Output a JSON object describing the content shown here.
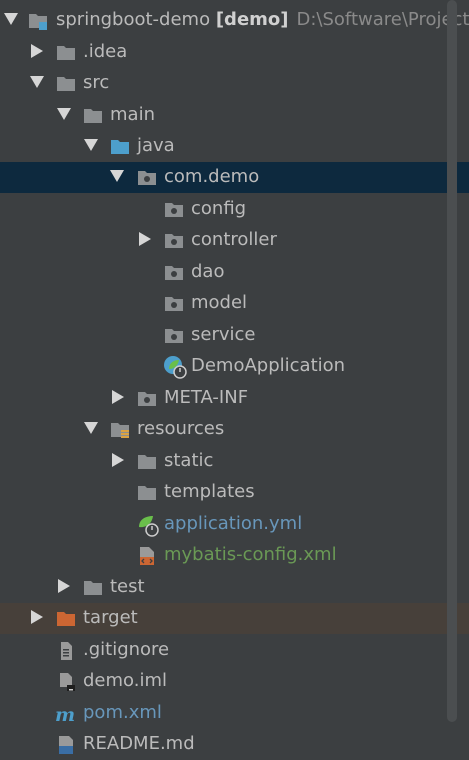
{
  "project": {
    "name": "springboot-demo",
    "module": "[demo]",
    "path": "D:\\Software\\Project"
  },
  "tree": {
    "idea": ".idea",
    "src": "src",
    "main": "main",
    "java": "java",
    "comdemo": "com.demo",
    "config": "config",
    "controller": "controller",
    "dao": "dao",
    "model": "model",
    "service": "service",
    "demoapp": "DemoApplication",
    "metainf": "META-INF",
    "resources": "resources",
    "static": "static",
    "templates": "templates",
    "appyml": "application.yml",
    "mybatis": "mybatis-config.xml",
    "test": "test",
    "target": "target",
    "gitignore": ".gitignore",
    "demoiml": "demo.iml",
    "pom": "pom.xml",
    "readme": "README.md"
  },
  "colors": {
    "background": "#3c3f41",
    "selected_row": "#0d293e",
    "excluded_row": "#47403a",
    "folder": "#8c8f91",
    "source_folder": "#4d9fcc",
    "excluded_folder": "#cc6633",
    "text": "#bbbbbb",
    "modified_blue": "#6897bb",
    "added_green": "#6a9955"
  }
}
